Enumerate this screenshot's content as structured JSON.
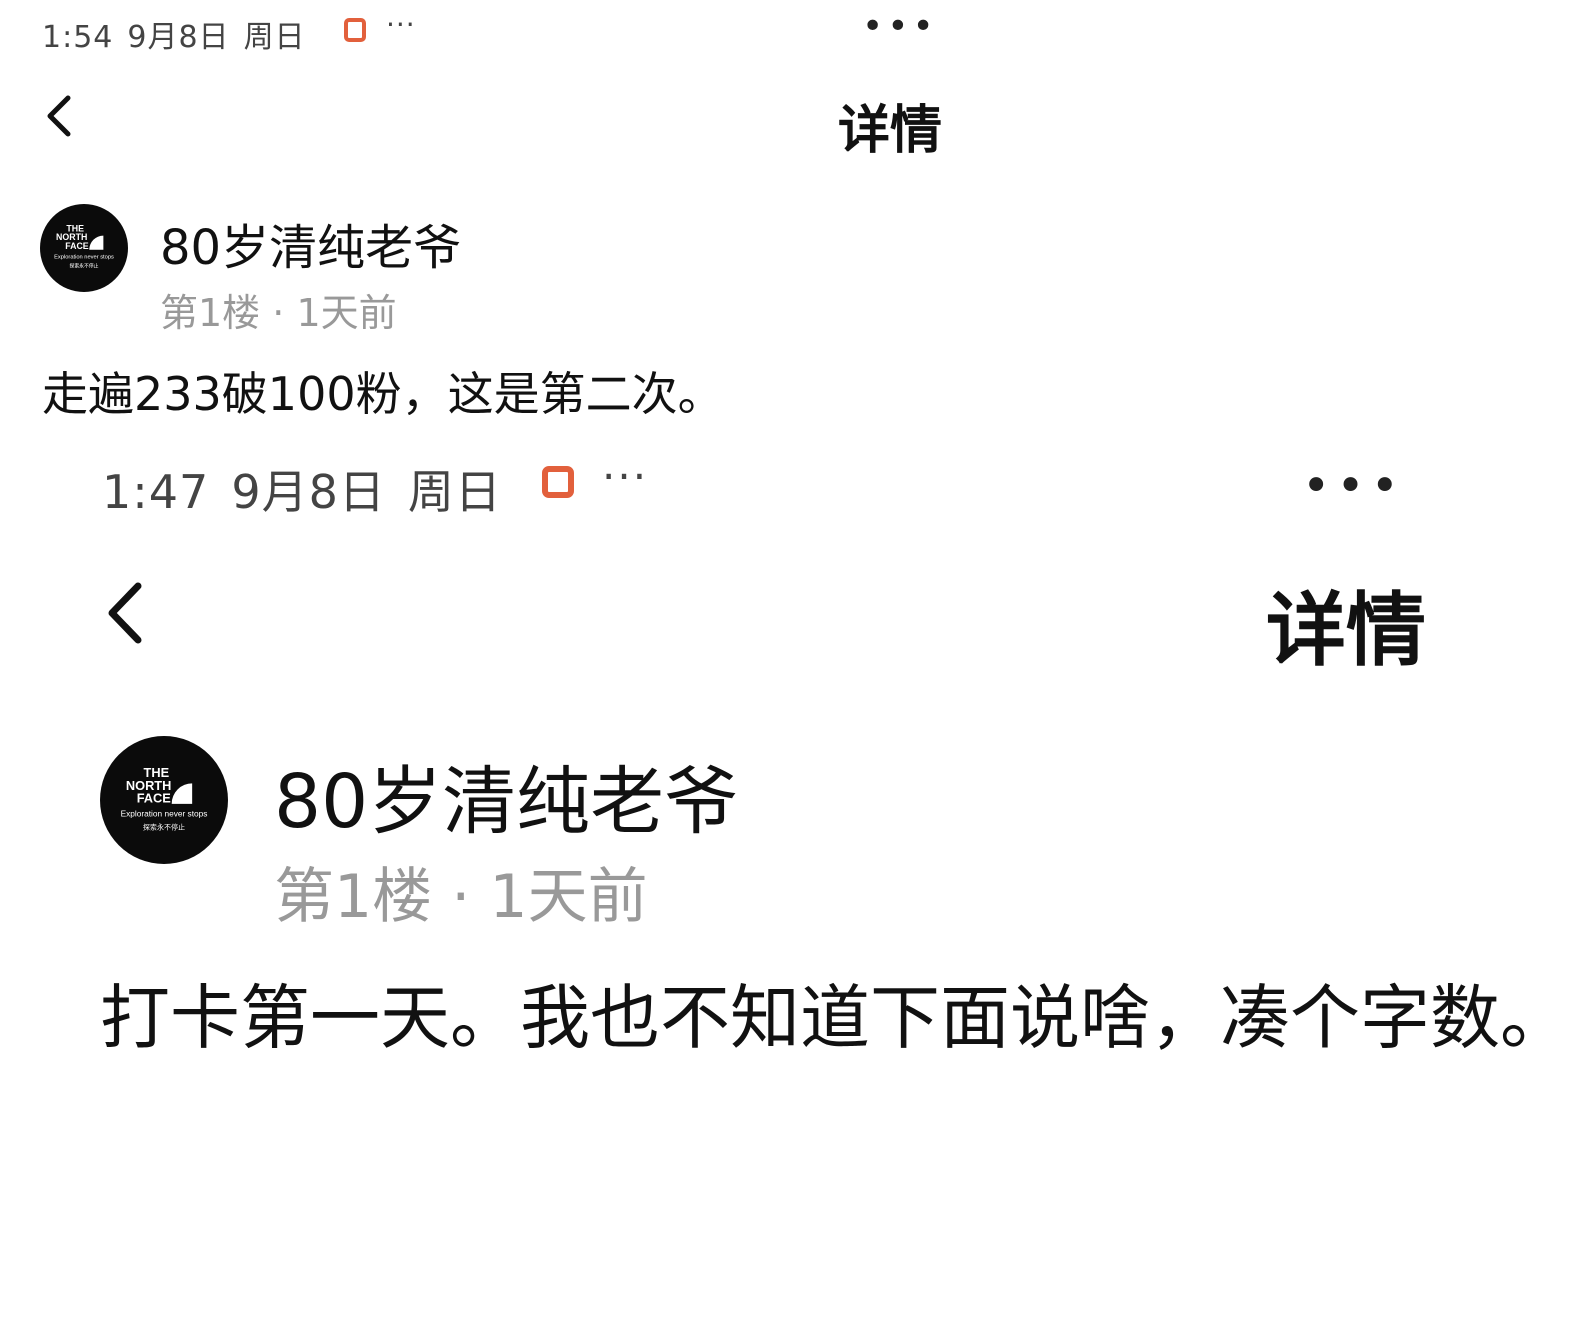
{
  "screens": [
    {
      "status_bar": {
        "time": "1:54",
        "date": "9月8日",
        "weekday": "周日",
        "overflow": "···"
      },
      "top_overflow": "•••",
      "nav": {
        "title": "详情"
      },
      "post": {
        "author": "80岁清纯老爷",
        "floor": "第1楼",
        "separator": "·",
        "time_ago": "1天前",
        "content": "走遍233破100粉，这是第二次。"
      }
    },
    {
      "status_bar": {
        "time": "1:47",
        "date": "9月8日",
        "weekday": "周日",
        "overflow": "···"
      },
      "top_overflow": "•••",
      "nav": {
        "title": "详情"
      },
      "post": {
        "author": "80岁清纯老爷",
        "floor": "第1楼",
        "separator": "·",
        "time_ago": "1天前",
        "content": "打卡第一天。我也不知道下面说啥，凑个字数。"
      }
    }
  ],
  "avatar_logo": {
    "line1": "THE",
    "line2": "NORTH",
    "line3": "FACE",
    "tagline": "Exploration never stops",
    "tagline_cn": "探索永不停止"
  },
  "colors": {
    "accent": "#e2603c",
    "text": "#111111",
    "muted": "#999999"
  },
  "icons": {
    "back": "chevron-left-icon",
    "notification": "notification-icon",
    "more": "more-icon"
  }
}
